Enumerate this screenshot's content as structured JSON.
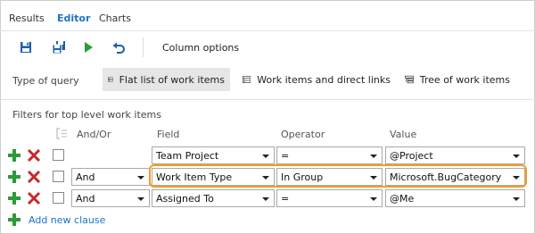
{
  "tabs": [
    {
      "label": "Results",
      "active": false
    },
    {
      "label": "Editor",
      "active": true
    },
    {
      "label": "Charts",
      "active": false
    }
  ],
  "toolbar": {
    "save_icon": "save-icon",
    "save_as_icon": "save-as-icon",
    "run_icon": "run-icon",
    "undo_icon": "undo-icon",
    "column_options_label": "Column options"
  },
  "query_type": {
    "label": "Type of query",
    "options": [
      {
        "label": "Flat list of work items",
        "selected": true,
        "icon": "flat-list-icon"
      },
      {
        "label": "Work items and direct links",
        "selected": false,
        "icon": "direct-links-icon"
      },
      {
        "label": "Tree of work items",
        "selected": false,
        "icon": "tree-icon"
      }
    ]
  },
  "filters": {
    "title": "Filters for top level work items",
    "headers": {
      "andor": "And/Or",
      "field": "Field",
      "operator": "Operator",
      "value": "Value"
    },
    "rows": [
      {
        "andor": "",
        "field": "Team Project",
        "operator": "=",
        "value": "@Project",
        "highlighted": false
      },
      {
        "andor": "And",
        "field": "Work Item Type",
        "operator": "In Group",
        "value": "Microsoft.BugCategory",
        "highlighted": true
      },
      {
        "andor": "And",
        "field": "Assigned To",
        "operator": "=",
        "value": "@Me",
        "highlighted": false
      }
    ],
    "add_clause_label": "Add new clause"
  },
  "colors": {
    "accent": "#1a73c8",
    "add": "#2e9a3a",
    "delete": "#c62828",
    "highlight": "#f39c1f"
  }
}
